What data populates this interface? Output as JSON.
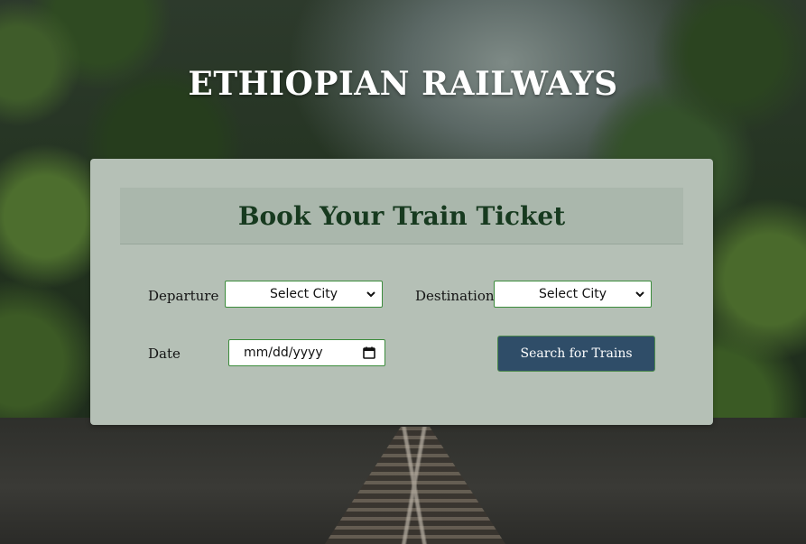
{
  "header": {
    "title": "ETHIOPIAN RAILWAYS"
  },
  "form": {
    "heading": "Book Your Train Ticket",
    "departure_label": "Departure",
    "departure_selected": "Select City",
    "destination_label": "Destination",
    "destination_selected": "Select City",
    "date_label": "Date",
    "date_value": "mm/dd/yyyy",
    "search_button": "Search for Trains"
  },
  "colors": {
    "card_background": "#b5c0b6",
    "heading_text": "#173a1f",
    "button_background": "#2f4d68",
    "input_border": "#3c8c3c"
  },
  "icons": {
    "select_arrow": "chevron-down-icon",
    "date_picker": "calendar-icon"
  }
}
